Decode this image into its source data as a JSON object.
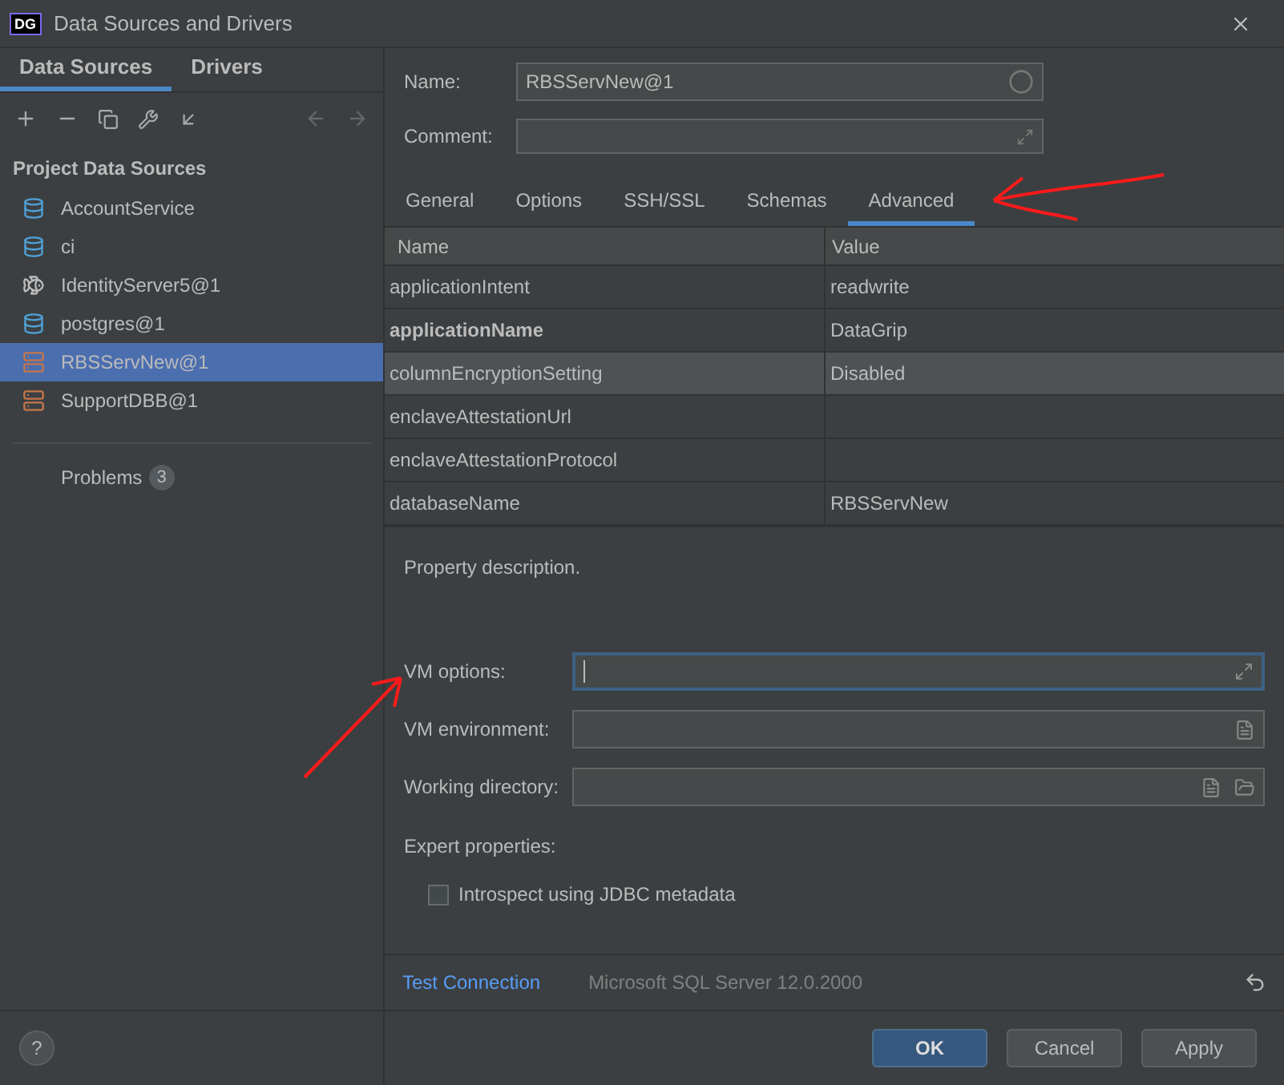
{
  "window": {
    "title": "Data Sources and Drivers",
    "logo": "DG"
  },
  "left_tabs": [
    {
      "label": "Data Sources",
      "selected": true
    },
    {
      "label": "Drivers",
      "selected": false
    }
  ],
  "section_title": "Project Data Sources",
  "sources": [
    {
      "label": "AccountService",
      "kind": "elephant",
      "selected": false
    },
    {
      "label": "ci",
      "kind": "elephant",
      "selected": false
    },
    {
      "label": "IdentityServer5@1",
      "kind": "dolphin",
      "selected": false
    },
    {
      "label": "postgres@1",
      "kind": "elephant",
      "selected": false
    },
    {
      "label": "RBSServNew@1",
      "kind": "server",
      "selected": true
    },
    {
      "label": "SupportDBB@1",
      "kind": "server",
      "selected": false
    }
  ],
  "problems": {
    "label": "Problems",
    "count": "3"
  },
  "name_field": {
    "label": "Name:",
    "value": "RBSServNew@1"
  },
  "comment_field": {
    "label": "Comment:"
  },
  "tabs": [
    {
      "label": "General",
      "selected": false
    },
    {
      "label": "Options",
      "selected": false
    },
    {
      "label": "SSH/SSL",
      "selected": false
    },
    {
      "label": "Schemas",
      "selected": false
    },
    {
      "label": "Advanced",
      "selected": true
    }
  ],
  "table": {
    "columns": [
      "Name",
      "Value"
    ],
    "rows": [
      {
        "name": "applicationIntent",
        "value": "readwrite",
        "bold": false,
        "selected": false
      },
      {
        "name": "applicationName",
        "value": "DataGrip",
        "bold": true,
        "selected": false
      },
      {
        "name": "columnEncryptionSetting",
        "value": "Disabled",
        "bold": false,
        "selected": true
      },
      {
        "name": "enclaveAttestationUrl",
        "bold": false,
        "selected": false
      },
      {
        "name": "enclaveAttestationProtocol",
        "bold": false,
        "selected": false
      },
      {
        "name": "databaseName",
        "value": "RBSServNew",
        "bold": false,
        "selected": false
      }
    ]
  },
  "description": "Property description.",
  "vm_fields": [
    {
      "label": "VM options:",
      "kind": "expand",
      "focused": true
    },
    {
      "label": "VM environment:",
      "kind": "list",
      "focused": false
    },
    {
      "label": "Working directory:",
      "kind": "folder",
      "focused": false
    }
  ],
  "expert_title": "Expert properties:",
  "introspect": {
    "label": "Introspect using JDBC metadata",
    "checked": false
  },
  "test_connection": "Test Connection",
  "driver_version": "Microsoft SQL Server 12.0.2000",
  "buttons": [
    {
      "label": "OK",
      "primary": true
    },
    {
      "label": "Cancel",
      "primary": false
    },
    {
      "label": "Apply",
      "primary": false
    }
  ],
  "help": "?"
}
